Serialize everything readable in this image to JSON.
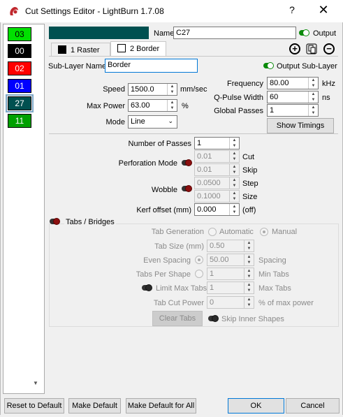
{
  "title": "Cut Settings Editor - LightBurn 1.7.08",
  "window": {
    "help": "?",
    "close": "✕"
  },
  "layers": [
    {
      "label": "03",
      "bg": "#00e000",
      "fg": "#000000"
    },
    {
      "label": "00",
      "bg": "#000000",
      "fg": "#ffffff"
    },
    {
      "label": "02",
      "bg": "#ff0000",
      "fg": "#ffffff"
    },
    {
      "label": "01",
      "bg": "#0000ff",
      "fg": "#ffffff"
    },
    {
      "label": "27",
      "bg": "#005050",
      "fg": "#ffffff",
      "selected": true
    },
    {
      "label": "11",
      "bg": "#00a000",
      "fg": "#ffffff"
    }
  ],
  "colors": {
    "layer_color": "#005050",
    "accent": "#0a8a0a",
    "toggle_off": "#8b1010"
  },
  "header": {
    "name_label": "Name",
    "name_value": "C27",
    "output_label": "Output"
  },
  "tabs": [
    {
      "label": "1 Raster",
      "swatch": "#000000"
    },
    {
      "label": "2 Border",
      "swatch": "#ffffff",
      "active": true
    }
  ],
  "sublayer": {
    "label": "Sub-Layer Name",
    "value": "Border",
    "output_label": "Output Sub-Layer"
  },
  "speed": {
    "label": "Speed",
    "value": "1500.0",
    "unit": "mm/sec"
  },
  "max_power": {
    "label": "Max Power",
    "value": "63.00",
    "unit": "%"
  },
  "mode": {
    "label": "Mode",
    "value": "Line"
  },
  "frequency": {
    "label": "Frequency",
    "value": "80.00",
    "unit": "kHz"
  },
  "qpulse": {
    "label": "Q-Pulse Width",
    "value": "60",
    "unit": "ns"
  },
  "global_passes": {
    "label": "Global Passes",
    "value": "1"
  },
  "show_timings": "Show Timings",
  "passes": {
    "label": "Number of Passes",
    "value": "1"
  },
  "perforation": {
    "label": "Perforation Mode",
    "cut_value": "0.01",
    "cut_label": "Cut",
    "skip_value": "0.01",
    "skip_label": "Skip"
  },
  "wobble": {
    "label": "Wobble",
    "step_value": "0.0500",
    "step_label": "Step",
    "size_value": "0.1000",
    "size_label": "Size"
  },
  "kerf": {
    "label": "Kerf offset (mm)",
    "value": "0.000",
    "suffix": "(off)"
  },
  "tabs_bridges": {
    "label": "Tabs / Bridges",
    "generation_label": "Tab Generation",
    "automatic": "Automatic",
    "manual": "Manual",
    "size_label": "Tab Size (mm)",
    "size_value": "0.50",
    "even_spacing_label": "Even Spacing",
    "spacing_value": "50.00",
    "spacing_label": "Spacing",
    "per_shape_label": "Tabs Per Shape",
    "per_shape_value": "1",
    "min_tabs_label": "Min Tabs",
    "limit_label": "Limit Max Tabs",
    "limit_value": "1",
    "max_tabs_label": "Max Tabs",
    "cut_power_label": "Tab Cut Power",
    "cut_power_value": "0",
    "cut_power_unit": "% of max power",
    "clear_tabs": "Clear Tabs",
    "skip_inner": "Skip Inner Shapes"
  },
  "footer": {
    "reset": "Reset to Default",
    "make_default": "Make Default",
    "make_default_all": "Make Default for All",
    "ok": "OK",
    "cancel": "Cancel"
  }
}
